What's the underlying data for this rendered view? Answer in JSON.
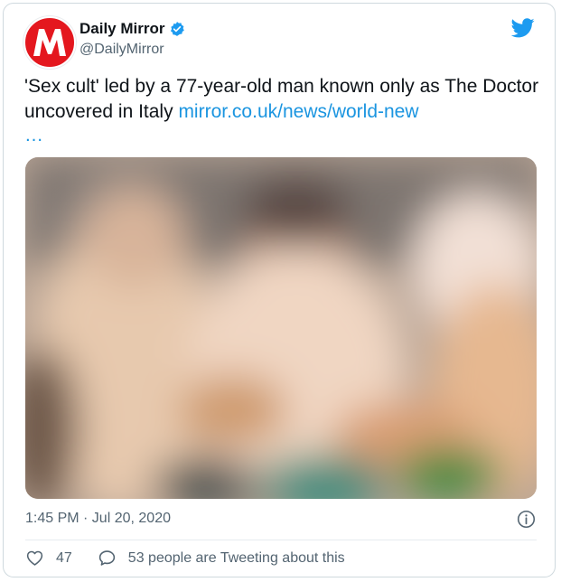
{
  "author": {
    "display_name": "Daily Mirror",
    "handle": "@DailyMirror",
    "avatar_icon": "mirror-logo-icon",
    "verified_icon": "verified-badge-icon",
    "brand_color": "#e4171e"
  },
  "platform_icon": "twitter-bird-icon",
  "platform_color": "#1d9bf0",
  "tweet": {
    "text": "'Sex cult' led by a 77-year-old man known only as The Doctor uncovered in Italy ",
    "link_text": "mirror.co.uk/news/world-new",
    "link_ellipsis": "…",
    "link_color": "#1b95e0",
    "media_description": "blurred photo",
    "timestamp": "1:45 PM · Jul 20, 2020",
    "info_icon": "info-icon"
  },
  "stats": {
    "like_icon": "heart-icon",
    "likes": "47",
    "reply_icon": "speech-bubble-icon",
    "conversation": "53 people are Tweeting about this"
  }
}
